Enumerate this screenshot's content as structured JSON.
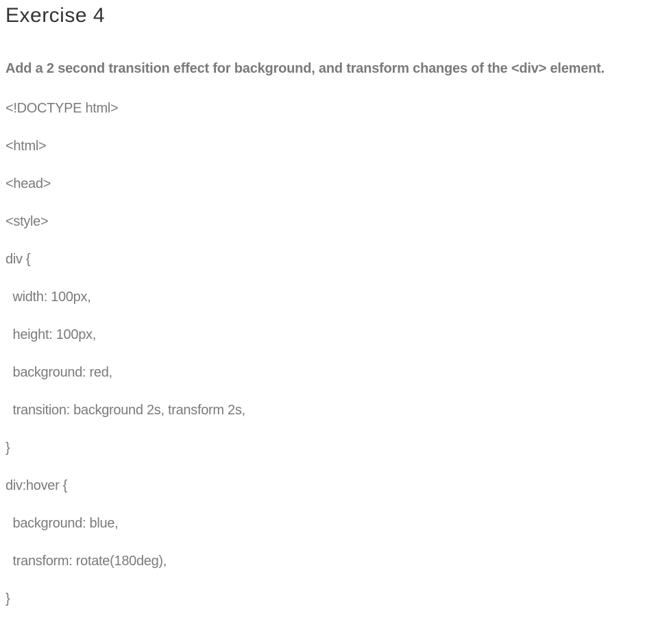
{
  "heading": "Exercise 4",
  "instruction": "Add a 2 second transition effect for background, and transform changes of the <div> element.",
  "code_lines": [
    "<!DOCTYPE html>",
    "<html>",
    "<head>",
    "<style>",
    "div {",
    "  width: 100px,",
    "  height: 100px,",
    "  background: red,",
    "  transition: background 2s, transform 2s,",
    "}",
    "div:hover {",
    "  background: blue,",
    "  transform: rotate(180deg),",
    "}"
  ]
}
